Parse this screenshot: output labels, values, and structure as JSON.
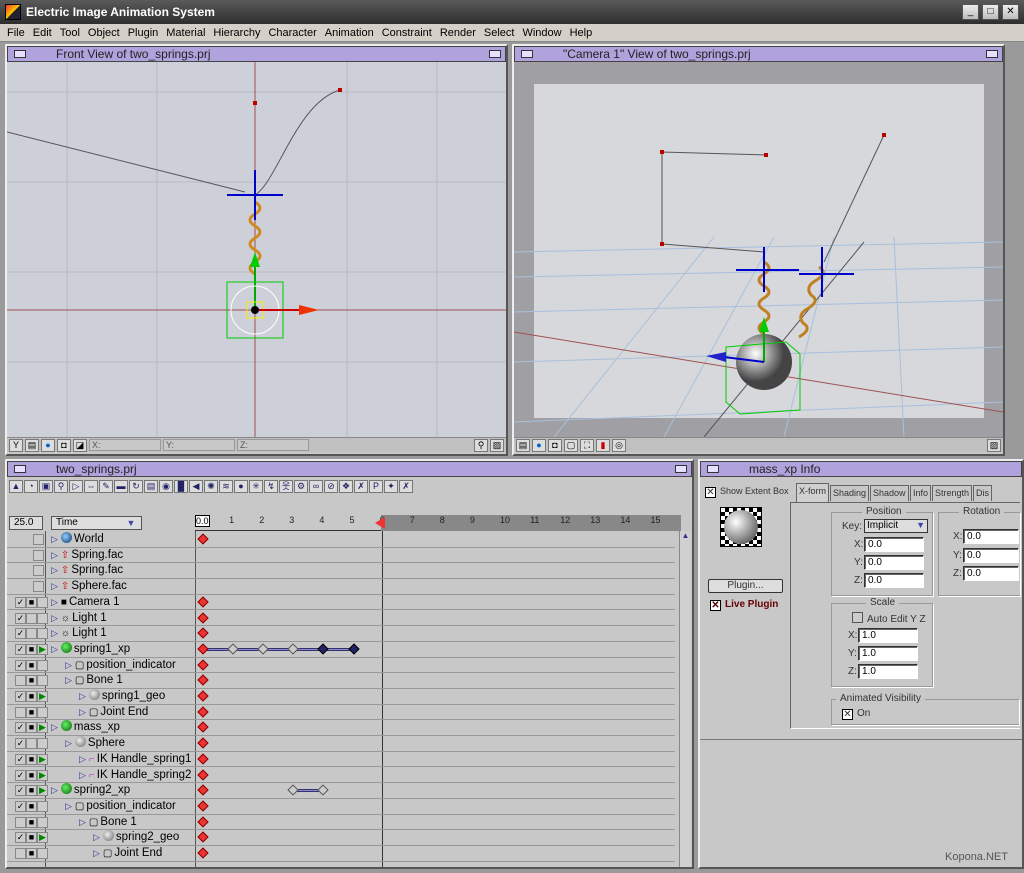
{
  "app": {
    "title": "Electric Image Animation System",
    "window_buttons": [
      "minimize",
      "maximize",
      "close"
    ]
  },
  "menu": [
    "File",
    "Edit",
    "Tool",
    "Object",
    "Plugin",
    "Material",
    "Hierarchy",
    "Character",
    "Animation",
    "Constraint",
    "Render",
    "Select",
    "Window",
    "Help"
  ],
  "front_view": {
    "title": "Front View of two_springs.prj",
    "coords": {
      "x": "X:",
      "y": "Y:",
      "z": "Z:"
    }
  },
  "camera_view": {
    "title": "\"Camera 1\" View of two_springs.prj"
  },
  "timeline": {
    "title": "two_springs.prj",
    "fps": "25.0",
    "time_mode": "Time",
    "current_time_label": "0.0",
    "ruler_ticks": [
      "1",
      "2",
      "3",
      "4",
      "5",
      "6",
      "7",
      "8",
      "9",
      "10",
      "11",
      "12",
      "13",
      "14",
      "15"
    ],
    "current_time": 6,
    "rows": [
      {
        "name": "World",
        "indent": 0,
        "icon": "globe-icon",
        "checks": "",
        "keys": [
          0
        ]
      },
      {
        "name": "Spring.fac",
        "indent": 0,
        "icon": "facet-icon",
        "checks": "",
        "keys": []
      },
      {
        "name": "Spring.fac",
        "indent": 0,
        "icon": "facet-icon",
        "checks": "",
        "keys": []
      },
      {
        "name": "Sphere.fac",
        "indent": 0,
        "icon": "facet-icon",
        "checks": "",
        "keys": []
      },
      {
        "name": "Camera 1",
        "indent": 0,
        "icon": "camera-icon",
        "checks": "vl-",
        "keys": [
          0
        ]
      },
      {
        "name": "Light 1",
        "indent": 0,
        "icon": "light-icon",
        "checks": "v--",
        "keys": [
          0
        ]
      },
      {
        "name": "Light 1",
        "indent": 0,
        "icon": "light-icon",
        "checks": "v--",
        "keys": [
          0
        ]
      },
      {
        "name": "spring1_xp",
        "indent": 0,
        "icon": "group-icon",
        "checks": "vlp",
        "keys": [
          0,
          1,
          2,
          3,
          4,
          5
        ]
      },
      {
        "name": "position_indicator",
        "indent": 1,
        "icon": "bone-icon",
        "checks": "vl-",
        "keys": [
          0
        ]
      },
      {
        "name": "Bone 1",
        "indent": 1,
        "icon": "bone-icon",
        "checks": "-l-",
        "keys": [
          0
        ]
      },
      {
        "name": "spring1_geo",
        "indent": 2,
        "icon": "geo-icon",
        "checks": "vlp",
        "keys": [
          0
        ]
      },
      {
        "name": "Joint End",
        "indent": 2,
        "icon": "bone-icon",
        "checks": "-l-",
        "keys": [
          0
        ]
      },
      {
        "name": "mass_xp",
        "indent": 0,
        "icon": "group-icon",
        "checks": "vlp",
        "keys": [
          0
        ]
      },
      {
        "name": "Sphere",
        "indent": 1,
        "icon": "geo-icon",
        "checks": "v--",
        "keys": [
          0
        ]
      },
      {
        "name": "IK Handle_spring1",
        "indent": 2,
        "icon": "ik-handle-icon",
        "checks": "vlp",
        "keys": [
          0
        ]
      },
      {
        "name": "IK Handle_spring2",
        "indent": 2,
        "icon": "ik-handle-icon",
        "checks": "vlp",
        "keys": [
          0
        ]
      },
      {
        "name": "spring2_xp",
        "indent": 0,
        "icon": "group-icon",
        "checks": "vlp",
        "keys": [
          0,
          3,
          4
        ]
      },
      {
        "name": "position_indicator",
        "indent": 1,
        "icon": "bone-icon",
        "checks": "vl-",
        "keys": [
          0
        ]
      },
      {
        "name": "Bone 1",
        "indent": 2,
        "icon": "bone-icon",
        "checks": "-l-",
        "keys": [
          0
        ]
      },
      {
        "name": "spring2_geo",
        "indent": 3,
        "icon": "geo-icon",
        "checks": "vlp",
        "keys": [
          0
        ]
      },
      {
        "name": "Joint End",
        "indent": 3,
        "icon": "bone-icon",
        "checks": "-l-",
        "keys": [
          0
        ]
      }
    ]
  },
  "info": {
    "title": "mass_xp Info",
    "show_extent_box": "Show Extent Box",
    "plugin_button": "Plugin...",
    "live_plugin": "Live Plugin",
    "tabs": [
      "X-form",
      "Shading",
      "Shadow",
      "Info",
      "Strength",
      "Dis"
    ],
    "active_tab": "X-form",
    "position": {
      "label": "Position",
      "key_label": "Key:",
      "key_value": "Implicit",
      "x": "0.0",
      "y": "0.0",
      "z": "0.0"
    },
    "rotation": {
      "label": "Rotation",
      "x": "0.0",
      "y": "0.0",
      "z": "0.0"
    },
    "scale": {
      "label": "Scale",
      "auto_edit": "Auto Edit Y Z",
      "x": "1.0",
      "y": "1.0",
      "z": "1.0"
    },
    "visibility": {
      "label": "Animated Visibility",
      "on": "On"
    },
    "axis_labels": {
      "x": "X:",
      "y": "Y:",
      "z": "Z:"
    }
  },
  "watermark": "Kopona.NET"
}
